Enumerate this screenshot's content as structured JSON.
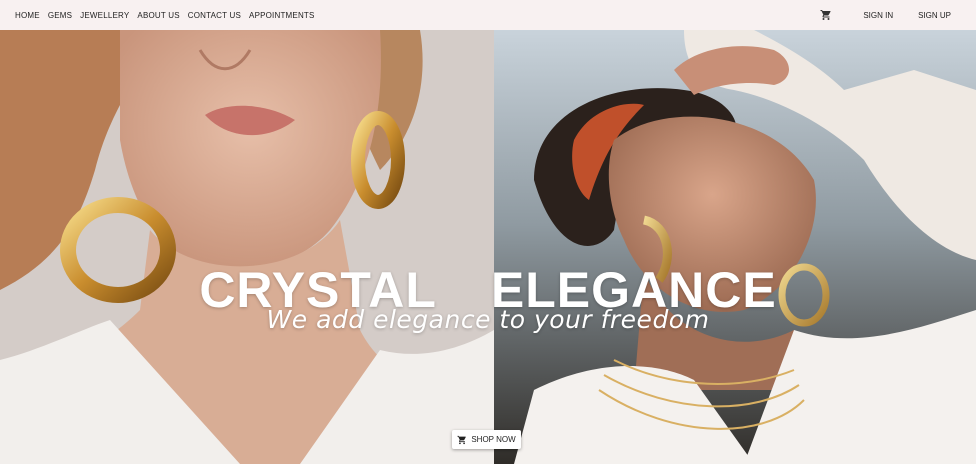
{
  "nav": {
    "links": [
      "HOME",
      "GEMS",
      "JEWELLERY",
      "ABOUT US",
      "CONTACT US",
      "APPOINTMENTS"
    ],
    "cart_icon": "cart-icon",
    "sign_in": "SIGN IN",
    "sign_up": "SIGN UP"
  },
  "hero": {
    "title": "CRYSTAL ELEGANCE",
    "tagline": "We add elegance to your freedom",
    "shop_button": "SHOP NOW",
    "shop_icon": "cart-icon"
  },
  "colors": {
    "navbar_bg": "#f8f1f1",
    "overlay_text": "#ffffff"
  }
}
